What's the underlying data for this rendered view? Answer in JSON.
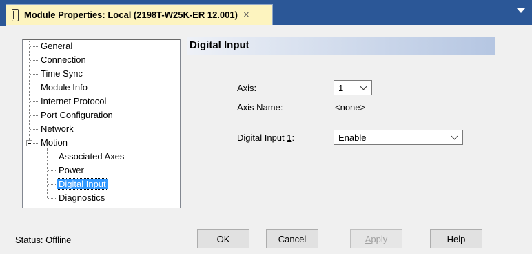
{
  "window": {
    "tab_title": "Module Properties: Local (2198T-W25K-ER 12.001)",
    "close_glyph": "×"
  },
  "tree": {
    "items": [
      {
        "label": "General"
      },
      {
        "label": "Connection"
      },
      {
        "label": "Time Sync"
      },
      {
        "label": "Module Info"
      },
      {
        "label": "Internet Protocol"
      },
      {
        "label": "Port Configuration"
      },
      {
        "label": "Network"
      },
      {
        "label": "Motion"
      },
      {
        "label": "Associated Axes"
      },
      {
        "label": "Power"
      },
      {
        "label": "Digital Input"
      },
      {
        "label": "Diagnostics"
      }
    ],
    "selected": "Digital Input"
  },
  "section": {
    "title": "Digital Input"
  },
  "form": {
    "axis_label_key": "A",
    "axis_label_rest": "xis:",
    "axis_value": "1",
    "axis_name_label": "Axis Name:",
    "axis_name_value": "<none>",
    "digital_input_label_pre": "Digital Input ",
    "digital_input_label_key": "1",
    "digital_input_label_post": ":",
    "digital_input_value": "Enable"
  },
  "status": {
    "text": "Status:  Offline"
  },
  "buttons": {
    "ok": "OK",
    "cancel": "Cancel",
    "apply_key": "A",
    "apply_rest": "pply",
    "help": "Help"
  },
  "colors": {
    "titlebar": "#2b5797",
    "tab": "#fdf4bf",
    "selection": "#3399ff"
  }
}
